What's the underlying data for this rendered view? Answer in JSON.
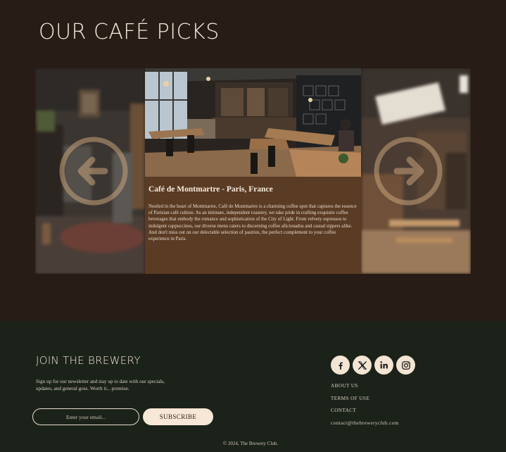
{
  "picks": {
    "title": "OUR CAFÉ PICKS"
  },
  "carousel": {
    "prev_icon": "arrow-left-icon",
    "next_icon": "arrow-right-icon",
    "active_card": {
      "title": "Café de Montmartre - Paris, France",
      "text": "Nestled in the heart of Montmartre, Café de Montmartre is a charming coffee spot that captures the essence of Parisian café culture. As an intimate, independent roastery, we take pride in crafting exquisite coffee beverages that embody the romance and sophistication of the City of Light. From velvety espressos to indulgent cappuccinos, our diverse menu caters to discerning coffee aficionados and casual sippers alike. And don't miss out on our delectable selection of pastries, the perfect complement to your coffee experience in Paris."
    }
  },
  "footer": {
    "join_title": "JOIN THE BREWERY",
    "join_text": "Sign up for our newsletter and stay up to date with our specials, updates, and general goss. Worth it... promise.",
    "email_placeholder": "Enter your email...",
    "subscribe_label": "SUBSCRIBE",
    "socials": [
      "facebook-icon",
      "x-icon",
      "linkedin-icon",
      "instagram-icon"
    ],
    "links": {
      "about": "ABOUT US",
      "terms": "TERMS OF USE",
      "contact": "CONTACT",
      "email": "contact@thebreweryclub.com"
    },
    "copyright": "© 2024, The Brewery Club."
  },
  "colors": {
    "page_bg": "#271d16",
    "footer_bg": "#1b2219",
    "card_bg": "#5a3b24",
    "accent": "#f6e7d6",
    "arrow": "#c9a27a"
  }
}
